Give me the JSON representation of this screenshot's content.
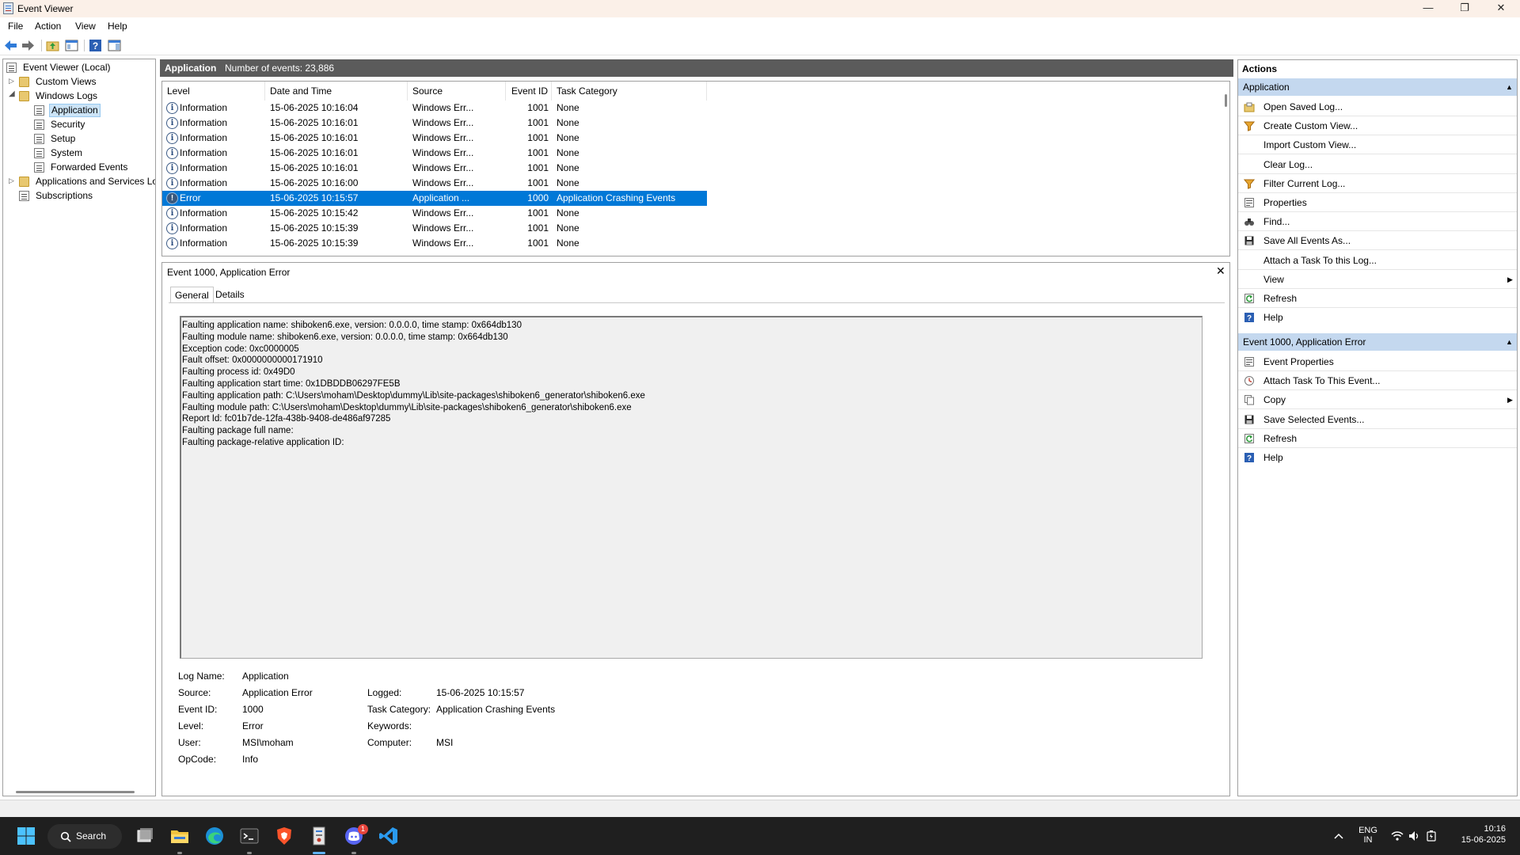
{
  "window": {
    "title": "Event Viewer",
    "controls": {
      "minimize": "—",
      "restore": "❐",
      "close": "✕"
    }
  },
  "menu": [
    "File",
    "Action",
    "View",
    "Help"
  ],
  "toolbar_icons": [
    "back-icon",
    "forward-icon",
    "folder-up-icon",
    "show-hide-tree-icon",
    "help-icon",
    "action-pane-icon"
  ],
  "tree": {
    "root": "Event Viewer (Local)",
    "custom_views": "Custom Views",
    "windows_logs": "Windows Logs",
    "logs": [
      "Application",
      "Security",
      "Setup",
      "System",
      "Forwarded Events"
    ],
    "apps_services": "Applications and Services Lo",
    "subscriptions": "Subscriptions"
  },
  "center_header": {
    "title": "Application",
    "count": "Number of events: 23,886"
  },
  "event_list": {
    "columns": [
      "Level",
      "Date and Time",
      "Source",
      "Event ID",
      "Task Category"
    ],
    "rows": [
      {
        "level": "Information",
        "date": "15-06-2025 10:16:04",
        "source": "Windows Err...",
        "id": "1001",
        "category": "None"
      },
      {
        "level": "Information",
        "date": "15-06-2025 10:16:01",
        "source": "Windows Err...",
        "id": "1001",
        "category": "None"
      },
      {
        "level": "Information",
        "date": "15-06-2025 10:16:01",
        "source": "Windows Err...",
        "id": "1001",
        "category": "None"
      },
      {
        "level": "Information",
        "date": "15-06-2025 10:16:01",
        "source": "Windows Err...",
        "id": "1001",
        "category": "None"
      },
      {
        "level": "Information",
        "date": "15-06-2025 10:16:01",
        "source": "Windows Err...",
        "id": "1001",
        "category": "None"
      },
      {
        "level": "Information",
        "date": "15-06-2025 10:16:00",
        "source": "Windows Err...",
        "id": "1001",
        "category": "None"
      },
      {
        "level": "Error",
        "date": "15-06-2025 10:15:57",
        "source": "Application ...",
        "id": "1000",
        "category": "Application Crashing Events"
      },
      {
        "level": "Information",
        "date": "15-06-2025 10:15:42",
        "source": "Windows Err...",
        "id": "1001",
        "category": "None"
      },
      {
        "level": "Information",
        "date": "15-06-2025 10:15:39",
        "source": "Windows Err...",
        "id": "1001",
        "category": "None"
      },
      {
        "level": "Information",
        "date": "15-06-2025 10:15:39",
        "source": "Windows Err...",
        "id": "1001",
        "category": "None"
      }
    ]
  },
  "details": {
    "title": "Event 1000, Application Error",
    "close": "✕",
    "tabs": [
      "General",
      "Details"
    ],
    "description": [
      "Faulting application name: shiboken6.exe, version: 0.0.0.0, time stamp: 0x664db130",
      "Faulting module name: shiboken6.exe, version: 0.0.0.0, time stamp: 0x664db130",
      "Exception code: 0xc0000005",
      "Fault offset: 0x0000000000171910",
      "Faulting process id: 0x49D0",
      "Faulting application start time: 0x1DBDDB06297FE5B",
      "Faulting application path: C:\\Users\\moham\\Desktop\\dummy\\Lib\\site-packages\\shiboken6_generator\\shiboken6.exe",
      "Faulting module path: C:\\Users\\moham\\Desktop\\dummy\\Lib\\site-packages\\shiboken6_generator\\shiboken6.exe",
      "Report Id: fc01b7de-12fa-438b-9408-de486af97285",
      "Faulting package full name:",
      "Faulting package-relative application ID:"
    ],
    "props": {
      "log_name_label": "Log Name:",
      "log_name": "Application",
      "source_label": "Source:",
      "source": "Application Error",
      "logged_label": "Logged:",
      "logged": "15-06-2025 10:15:57",
      "event_id_label": "Event ID:",
      "event_id": "1000",
      "task_category_label": "Task Category:",
      "task_category": "Application Crashing Events",
      "level_label": "Level:",
      "level": "Error",
      "keywords_label": "Keywords:",
      "keywords": "",
      "user_label": "User:",
      "user": "MSI\\moham",
      "computer_label": "Computer:",
      "computer": "MSI",
      "opcode_label": "OpCode:",
      "opcode": "Info"
    }
  },
  "actions": {
    "header": "Actions",
    "section1": "Application",
    "section1_items": [
      {
        "label": "Open Saved Log...",
        "icon": "open-log-icon"
      },
      {
        "label": "Create Custom View...",
        "icon": "filter-icon"
      },
      {
        "label": "Import Custom View...",
        "icon": ""
      },
      {
        "label": "Clear Log...",
        "icon": ""
      },
      {
        "label": "Filter Current Log...",
        "icon": "filter-icon"
      },
      {
        "label": "Properties",
        "icon": "properties-icon"
      },
      {
        "label": "Find...",
        "icon": "binoculars-icon"
      },
      {
        "label": "Save All Events As...",
        "icon": "save-icon"
      },
      {
        "label": "Attach a Task To this Log...",
        "icon": ""
      },
      {
        "label": "View",
        "icon": "",
        "submenu": true
      },
      {
        "label": "Refresh",
        "icon": "refresh-icon"
      },
      {
        "label": "Help",
        "icon": "help-icon"
      }
    ],
    "section2": "Event 1000, Application Error",
    "section2_items": [
      {
        "label": "Event Properties",
        "icon": "properties-icon"
      },
      {
        "label": "Attach Task To This Event...",
        "icon": "task-icon"
      },
      {
        "label": "Copy",
        "icon": "copy-icon",
        "submenu": true
      },
      {
        "label": "Save Selected Events...",
        "icon": "save-icon"
      },
      {
        "label": "Refresh",
        "icon": "refresh-icon"
      },
      {
        "label": "Help",
        "icon": "help-icon"
      }
    ]
  },
  "taskbar": {
    "search_label": "Search",
    "apps": [
      "start-icon",
      "task-view-icon",
      "file-explorer-icon",
      "edge-icon",
      "terminal-icon",
      "brave-icon",
      "event-viewer-icon",
      "discord-icon",
      "vscode-icon"
    ],
    "discord_badge": "1",
    "lang_line1": "ENG",
    "lang_line2": "IN",
    "time": "10:16",
    "date": "15-06-2025"
  },
  "colors": {
    "selection": "#0078d7",
    "section_header": "#c4d8ef",
    "center_header": "#5b5b5b",
    "taskbar": "#1f1f1f"
  }
}
